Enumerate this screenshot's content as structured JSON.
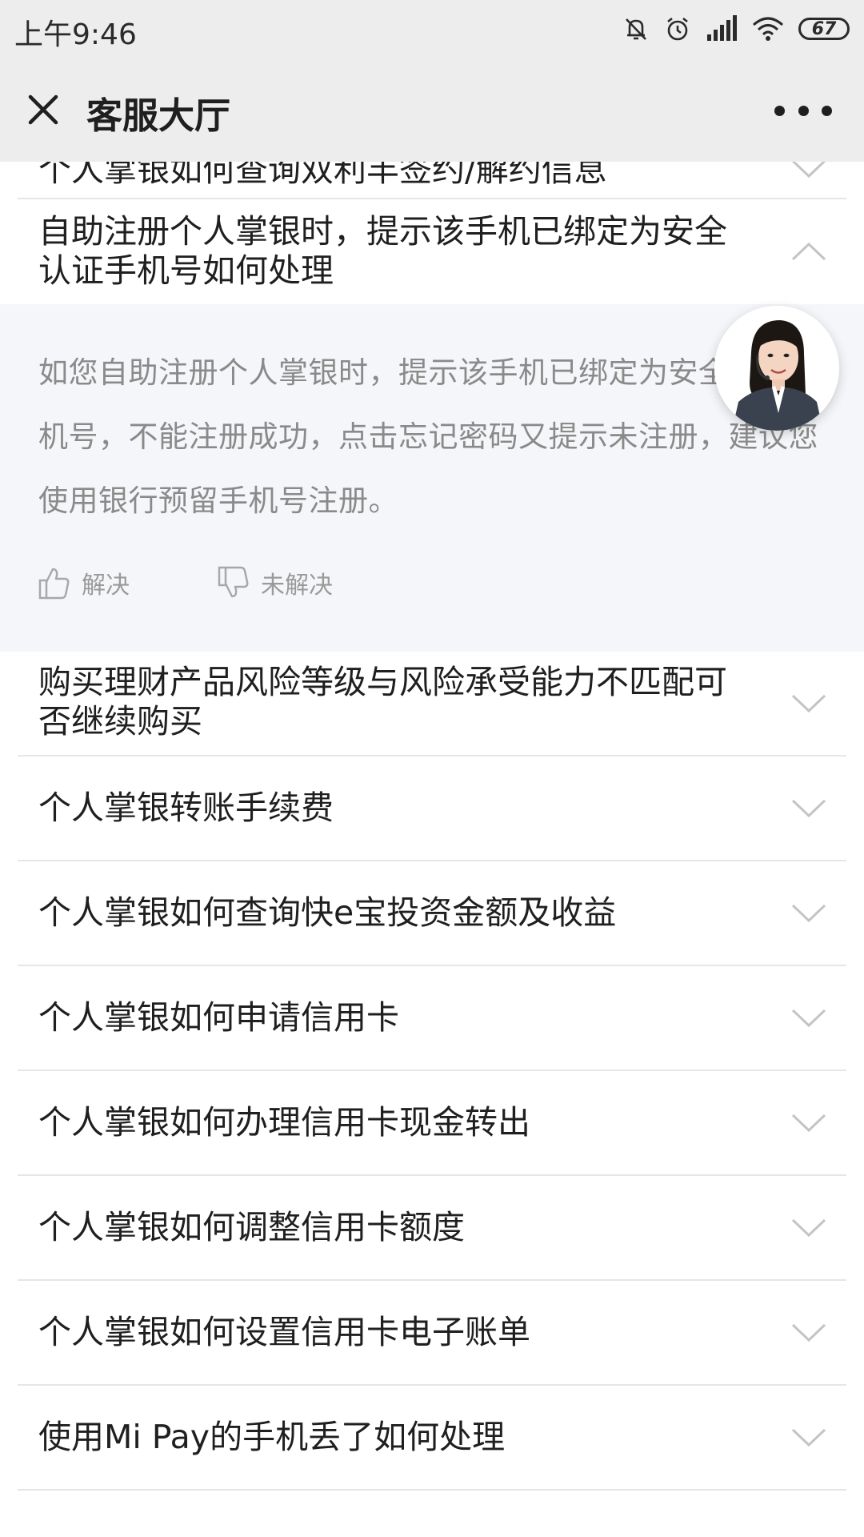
{
  "status_bar": {
    "time": "上午9:46",
    "battery": "67",
    "icons": [
      "mute-icon",
      "alarm-icon",
      "signal-icon",
      "wifi-icon",
      "battery-icon"
    ]
  },
  "nav": {
    "title": "客服大厅",
    "close_icon": "close-icon",
    "more_icon": "more-icon"
  },
  "faq": [
    {
      "q": "个人掌银如何查询双利丰签约/解约信息"
    },
    {
      "q": "自助注册个人掌银时，提示该手机已绑定为安全认证手机号如何处理"
    },
    {
      "q": "购买理财产品风险等级与风险承受能力不匹配可否继续购买"
    },
    {
      "q": "个人掌银转账手续费"
    },
    {
      "q": "个人掌银如何查询快e宝投资金额及收益"
    },
    {
      "q": "个人掌银如何申请信用卡"
    },
    {
      "q": "个人掌银如何办理信用卡现金转出"
    },
    {
      "q": "个人掌银如何调整信用卡额度"
    },
    {
      "q": "个人掌银如何设置信用卡电子账单"
    },
    {
      "q": "使用Mi Pay的手机丢了如何处理"
    }
  ],
  "answer": {
    "text": "如您自助注册个人掌银时，提示该手机已绑定为安全认证手机号，不能注册成功，点击忘记密码又提示未注册，建议您使用银行预留手机号注册。",
    "resolved_label": "解决",
    "unresolved_label": "未解决"
  },
  "colors": {
    "bar_bg": "#ededed",
    "answer_bg": "#f5f6f9",
    "divider": "#e6e6e6",
    "answer_text": "#8a8a8a"
  }
}
